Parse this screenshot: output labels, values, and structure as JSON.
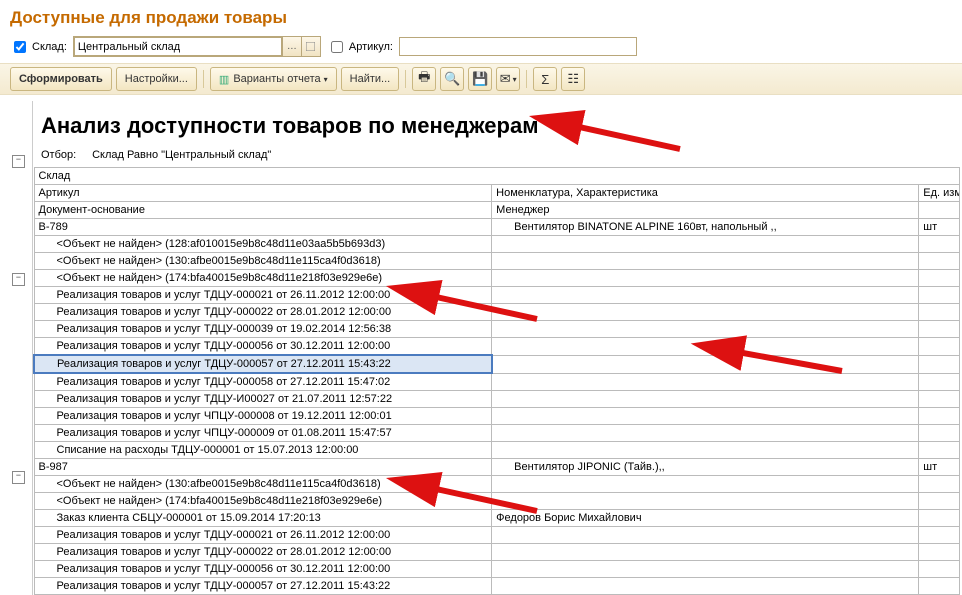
{
  "title": "Доступные для продажи товары",
  "filters": {
    "warehouse_chk_label": "Склад:",
    "warehouse_value": "Центральный склад",
    "sku_chk_label": "Артикул:",
    "sku_value": ""
  },
  "toolbar": {
    "run": "Сформировать",
    "settings": "Настройки...",
    "variants": "Варианты отчета",
    "find": "Найти..."
  },
  "report": {
    "heading": "Анализ доступности товаров по менеджерам",
    "filter_label": "Отбор:",
    "filter_text": "Склад Равно \"Центральный склад\"",
    "h_warehouse": "Склад",
    "h_sku": "Артикул",
    "h_nomen": "Номенклатура, Характеристика",
    "h_unit": "Ед. изм.",
    "h_doc": "Документ-основание",
    "h_manager": "Менеджер"
  },
  "groups": [
    {
      "sku": "В-789",
      "nomen": "Вентилятор BINATONE ALPINE 160вт, напольный ,,",
      "unit": "шт",
      "rows": [
        {
          "doc": "<Объект не найден> (128:af010015e9b8c48d11e03aa5b5b693d3)",
          "mgr": ""
        },
        {
          "doc": "<Объект не найден> (130:afbe0015e9b8c48d11e115ca4f0d3618)",
          "mgr": ""
        },
        {
          "doc": "<Объект не найден> (174:bfa40015e9b8c48d11e218f03e929e6e)",
          "mgr": ""
        },
        {
          "doc": "Реализация товаров и услуг ТДЦУ-000021 от 26.11.2012 12:00:00",
          "mgr": ""
        },
        {
          "doc": "Реализация товаров и услуг ТДЦУ-000022 от 28.01.2012 12:00:00",
          "mgr": ""
        },
        {
          "doc": "Реализация товаров и услуг ТДЦУ-000039 от 19.02.2014 12:56:38",
          "mgr": ""
        },
        {
          "doc": "Реализация товаров и услуг ТДЦУ-000056 от 30.12.2011 12:00:00",
          "mgr": ""
        },
        {
          "doc": "Реализация товаров и услуг ТДЦУ-000057 от 27.12.2011 15:43:22",
          "mgr": "",
          "hl": true
        },
        {
          "doc": "Реализация товаров и услуг ТДЦУ-000058 от 27.12.2011 15:47:02",
          "mgr": ""
        },
        {
          "doc": "Реализация товаров и услуг ТДЦУ-И00027 от 21.07.2011 12:57:22",
          "mgr": ""
        },
        {
          "doc": "Реализация товаров и услуг ЧПЦУ-000008 от 19.12.2011 12:00:01",
          "mgr": ""
        },
        {
          "doc": "Реализация товаров и услуг ЧПЦУ-000009 от 01.08.2011 15:47:57",
          "mgr": ""
        },
        {
          "doc": "Списание на расходы ТДЦУ-000001 от 15.07.2013 12:00:00",
          "mgr": ""
        }
      ]
    },
    {
      "sku": "В-987",
      "nomen": "Вентилятор JIPONIC (Тайв.),,",
      "unit": "шт",
      "rows": [
        {
          "doc": "<Объект не найден> (130:afbe0015e9b8c48d11e115ca4f0d3618)",
          "mgr": ""
        },
        {
          "doc": "<Объект не найден> (174:bfa40015e9b8c48d11e218f03e929e6e)",
          "mgr": ""
        },
        {
          "doc": "Заказ клиента СБЦУ-000001 от 15.09.2014 17:20:13",
          "mgr": "Федоров Борис Михайлович"
        },
        {
          "doc": "Реализация товаров и услуг ТДЦУ-000021 от 26.11.2012 12:00:00",
          "mgr": ""
        },
        {
          "doc": "Реализация товаров и услуг ТДЦУ-000022 от 28.01.2012 12:00:00",
          "mgr": ""
        },
        {
          "doc": "Реализация товаров и услуг ТДЦУ-000056 от 30.12.2011 12:00:00",
          "mgr": ""
        },
        {
          "doc": "Реализация товаров и услуг ТДЦУ-000057 от 27.12.2011 15:43:22",
          "mgr": ""
        }
      ]
    }
  ]
}
